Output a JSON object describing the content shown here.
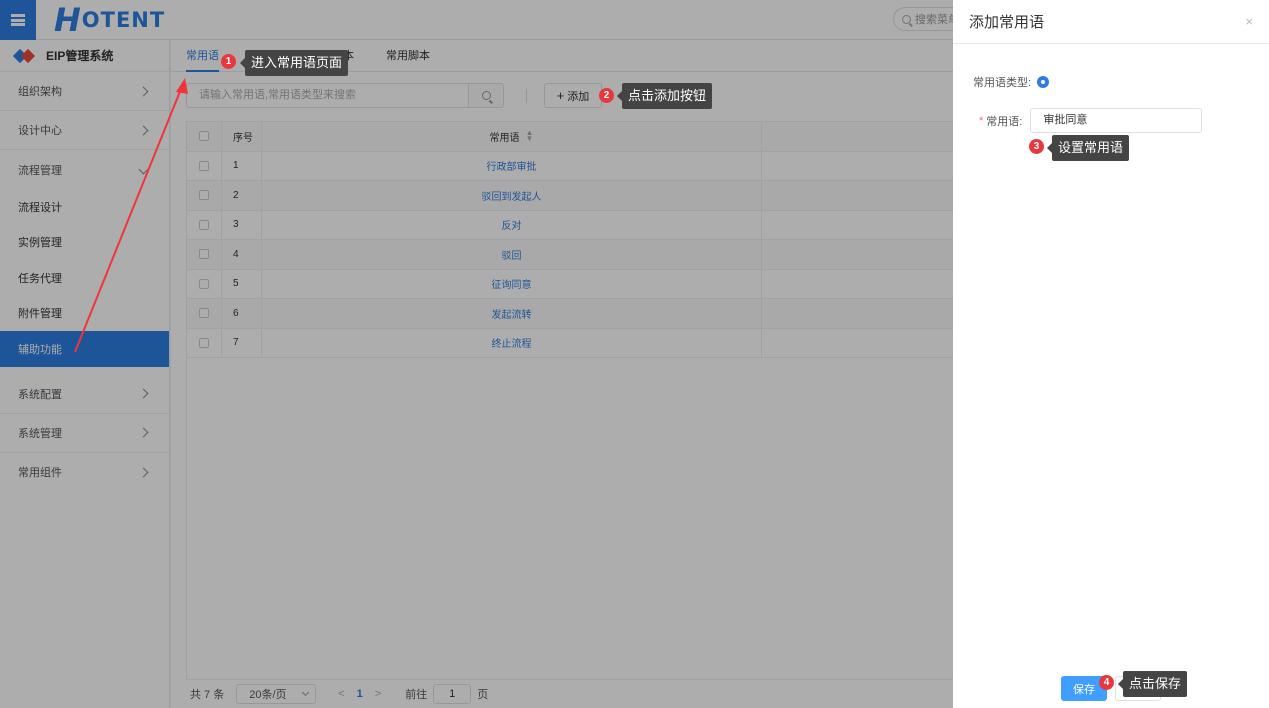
{
  "header": {
    "logo_h": "H",
    "logo_rest": "OTENT",
    "search_placeholder": "搜索菜单"
  },
  "sidebar": {
    "system_title": "EIP管理系统",
    "groups": [
      {
        "label": "组织架构"
      },
      {
        "label": "设计中心"
      },
      {
        "label": "流程管理"
      }
    ],
    "sub_items": [
      {
        "label": "流程设计"
      },
      {
        "label": "实例管理"
      },
      {
        "label": "任务代理"
      },
      {
        "label": "附件管理"
      },
      {
        "label": "辅助功能"
      }
    ],
    "bottom_groups": [
      {
        "label": "系统配置"
      },
      {
        "label": "系统管理"
      },
      {
        "label": "常用组件"
      }
    ]
  },
  "tabs": [
    {
      "label": "常用语"
    },
    {
      "label": "本"
    },
    {
      "label": "常用脚本"
    }
  ],
  "toolbar": {
    "search_placeholder": "请输入常用语,常用语类型来搜索",
    "add_label": "添加"
  },
  "table": {
    "headers": {
      "index": "序号",
      "phrase": "常用语"
    },
    "rows": [
      {
        "index": "1",
        "phrase": "行政部审批"
      },
      {
        "index": "2",
        "phrase": "驳回到发起人"
      },
      {
        "index": "3",
        "phrase": "反对"
      },
      {
        "index": "4",
        "phrase": "驳回"
      },
      {
        "index": "5",
        "phrase": "征询同意"
      },
      {
        "index": "6",
        "phrase": "发起流转"
      },
      {
        "index": "7",
        "phrase": "终止流程"
      }
    ]
  },
  "pagination": {
    "total": "共 7 条",
    "page_size": "20条/页",
    "prev": "<",
    "current_page": "1",
    "next": ">",
    "goto_prefix": "前往",
    "goto_value": "1",
    "goto_suffix": "页"
  },
  "drawer": {
    "title": "添加常用语",
    "close": "×",
    "type_label": "常用语类型:",
    "phrase_label": "常用语:",
    "phrase_value": "审批同意",
    "save_label": "保存"
  },
  "annotations": [
    {
      "num": "1",
      "text": "进入常用语页面"
    },
    {
      "num": "2",
      "text": "点击添加按钮"
    },
    {
      "num": "3",
      "text": "设置常用语"
    },
    {
      "num": "4",
      "text": "点击保存"
    }
  ],
  "colors": {
    "primary": "#2d7ee0",
    "button": "#409eff",
    "badge": "#e8383d",
    "tooltip": "#444444",
    "arrow": "#f0353a"
  }
}
